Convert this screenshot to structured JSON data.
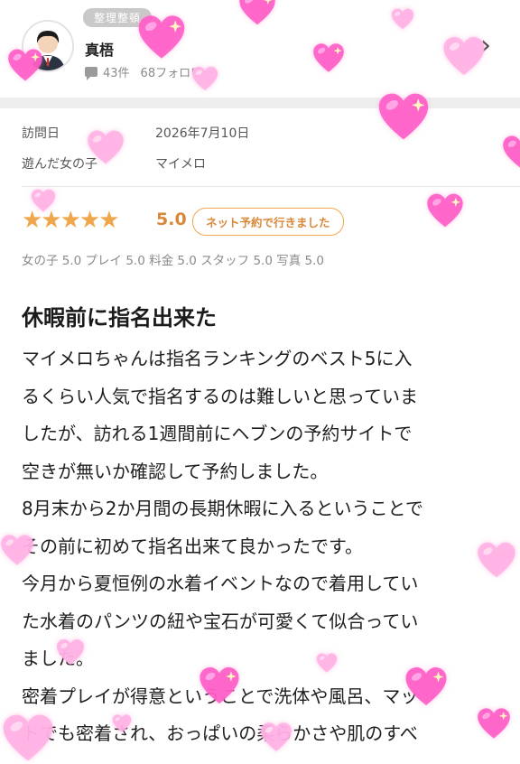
{
  "header": {
    "badge": "整理整頓",
    "user_name": "真梧",
    "posts": "43件",
    "followers": "68フォロワー",
    "chevron": "›"
  },
  "visit": {
    "date_label": "訪問日",
    "date_value": "2026年7月10日",
    "girl_label": "遊んだ女の子",
    "girl_value": "マイメロ"
  },
  "rating": {
    "stars": "★★★★★",
    "score": "5.0",
    "net_badge": "ネット予約で行きました",
    "sub_scores": "女の子 5.0  プレイ 5.0  料金 5.0  スタッフ 5.0  写真 5.0"
  },
  "review": {
    "title": "休暇前に指名出来た",
    "lines": [
      "マイメロちゃんは指名ランキングのベスト5に入",
      "るくらい人気で指名するのは難しいと思っていま",
      "したが、訪れる1週間前にヘブンの予約サイトで",
      "空きが無いか確認して予約しました。",
      "8月末から2か月間の長期休暇に入るということで",
      "その前に初めて指名出来て良かったです。",
      "今月から夏恒例の水着イベントなので着用してい",
      "た水着のパンツの紐や宝石が可愛くて似合ってい",
      "ました。",
      "密着プレイが得意ということで洗体や風呂、マッ",
      "トでも密着され、おっぱいの柔らかさや肌のすべ"
    ]
  },
  "colors": {
    "accent": "#f0a64b",
    "heart_pink": "#ff5cc8",
    "heart_light": "#ffb3e6"
  }
}
